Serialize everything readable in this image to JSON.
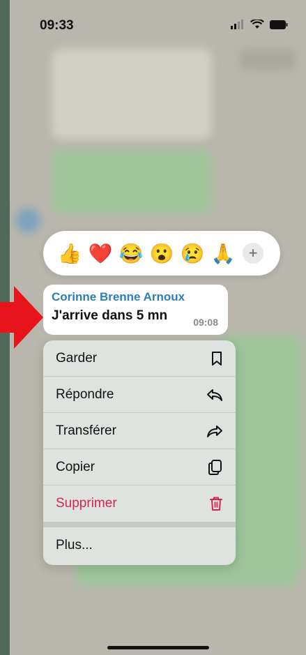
{
  "status_bar": {
    "time": "09:33"
  },
  "reactions": [
    {
      "emoji": "👍",
      "icon": "thumbs-up-emoji"
    },
    {
      "emoji": "❤️",
      "icon": "red-heart-emoji"
    },
    {
      "emoji": "😂",
      "icon": "tears-of-joy-emoji"
    },
    {
      "emoji": "😮",
      "icon": "open-mouth-emoji"
    },
    {
      "emoji": "😢",
      "icon": "crying-face-emoji"
    },
    {
      "emoji": "🙏",
      "icon": "folded-hands-emoji"
    }
  ],
  "reactions_more": "+",
  "message": {
    "sender": "Corinne Brenne Arnoux",
    "text": "J'arrive dans 5 mn",
    "time": "09:08",
    "sender_color": "#2a7fb8"
  },
  "menu": {
    "items": [
      {
        "label": "Garder",
        "icon": "bookmark-icon"
      },
      {
        "label": "Répondre",
        "icon": "reply-icon"
      },
      {
        "label": "Transférer",
        "icon": "forward-icon"
      },
      {
        "label": "Copier",
        "icon": "copy-icon"
      },
      {
        "label": "Supprimer",
        "icon": "trash-icon",
        "color": "#d2254f"
      }
    ],
    "more_label": "Plus..."
  },
  "annotation_arrow_color": "#e8141b"
}
